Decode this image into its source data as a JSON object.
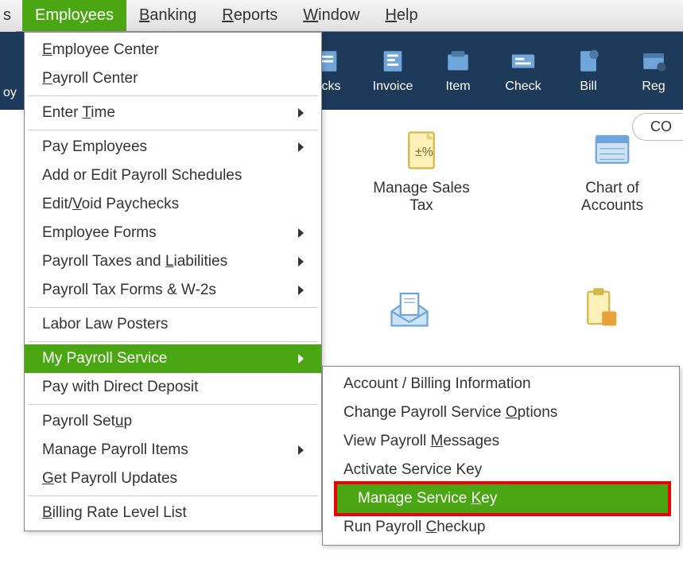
{
  "menubar": {
    "s_frag": "s",
    "employees": "Employees",
    "banking": "Banking",
    "reports": "Reports",
    "window": "Window",
    "help": "Help"
  },
  "toolbar": {
    "oy_frag": "oy",
    "ecks": "ecks",
    "invoice": "Invoice",
    "item": "Item",
    "check": "Check",
    "bill": "Bill",
    "reg": "Reg"
  },
  "dropdown": {
    "employee_center": "Employee Center",
    "payroll_center": "Payroll Center",
    "enter_time": "Enter Time",
    "pay_employees": "Pay Employees",
    "add_edit_schedules": "Add or Edit Payroll Schedules",
    "edit_void": "Edit/Void Paychecks",
    "employee_forms": "Employee Forms",
    "taxes_liab": "Payroll Taxes and Liabilities",
    "tax_forms_w2": "Payroll Tax Forms & W-2s",
    "labor_law": "Labor Law Posters",
    "my_payroll_service": "My Payroll Service",
    "pay_direct_deposit": "Pay with Direct Deposit",
    "payroll_setup": "Payroll Setup",
    "manage_payroll_items": "Manage Payroll Items",
    "get_payroll_updates": "Get Payroll Updates",
    "billing_rate": "Billing Rate Level List"
  },
  "submenu": {
    "account_billing": "Account / Billing Information",
    "change_options": "Change Payroll Service Options",
    "view_messages": "View Payroll Messages",
    "activate_key": "Activate Service Key",
    "manage_key": "Manage Service Key",
    "run_checkup": "Run Payroll Checkup"
  },
  "cards": {
    "manage_sales_tax": "Manage Sales Tax",
    "chart_of_accounts": "Chart of Accounts"
  },
  "pill": {
    "co": "CO"
  }
}
